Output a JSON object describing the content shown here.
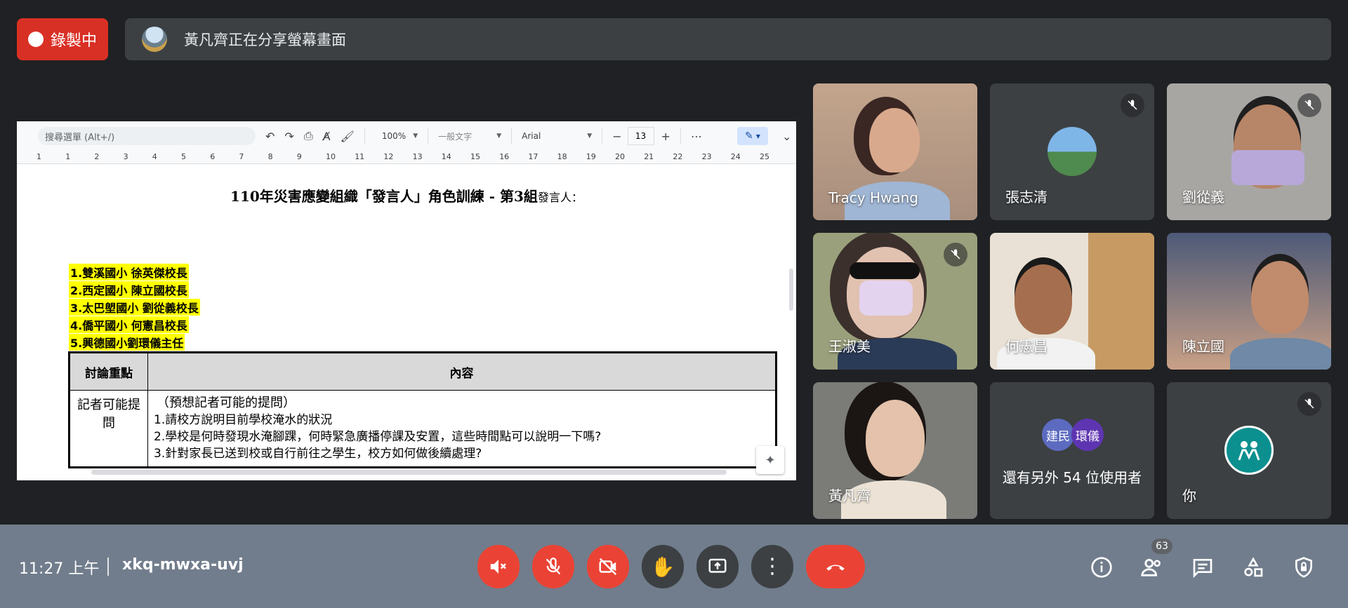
{
  "recording": {
    "label": "錄製中"
  },
  "share_banner": {
    "text": "黃凡齊正在分享螢幕畫面"
  },
  "doc": {
    "search_placeholder": "搜尋選單 (Alt+/)",
    "zoom": "100%",
    "style": "一般文字",
    "font": "Arial",
    "font_size": "13",
    "ruler_ticks": [
      "1",
      "1",
      "2",
      "3",
      "4",
      "5",
      "6",
      "7",
      "8",
      "9",
      "10",
      "11",
      "12",
      "13",
      "14",
      "15",
      "16",
      "17",
      "18",
      "19",
      "20",
      "21",
      "22",
      "23",
      "24",
      "25"
    ],
    "title": "110年災害應變組織「發言人」角色訓練 - 第3組",
    "title_suffix": "發言人：",
    "members": [
      "1.雙溪國小 徐英傑校長",
      "2.西定國小 陳立國校長",
      "3.太巴塱國小 劉從義校長",
      "4.僑平國小 何憲昌校長",
      "5.興德國小劉環儀主任"
    ],
    "table": {
      "headers": [
        "討論重點",
        "內容"
      ],
      "row_label": "記者可能提問",
      "row_lines": [
        "（預想記者可能的提問）",
        "1.請校方說明目前學校淹水的狀況",
        "2.學校是何時發現水淹腳踝，何時緊急廣播停課及安置，這些時間點可以說明一下嗎?",
        "3.針對家長已送到校或自行前往之學生，校方如何做後續處理?"
      ]
    }
  },
  "participants": [
    {
      "name": "Tracy Hwang",
      "muted": false
    },
    {
      "name": "張志清",
      "muted": true
    },
    {
      "name": "劉從義",
      "muted": true
    },
    {
      "name": "王淑美",
      "muted": true
    },
    {
      "name": "何憲昌",
      "muted": false
    },
    {
      "name": "陳立國",
      "muted": false
    },
    {
      "name": "黃凡齊",
      "muted": false
    },
    {
      "name": "還有另外 54 位使用者",
      "muted": false,
      "avatars": [
        "建民",
        "環儀"
      ]
    },
    {
      "name": "你",
      "muted": true
    }
  ],
  "bottom": {
    "time": "11:27 上午",
    "meeting_code": "xkq-mwxa-uvj",
    "people_count": "63"
  },
  "colors": {
    "accent_red": "#ea4335",
    "bar": "#717d8c",
    "tile": "#3c4043"
  }
}
